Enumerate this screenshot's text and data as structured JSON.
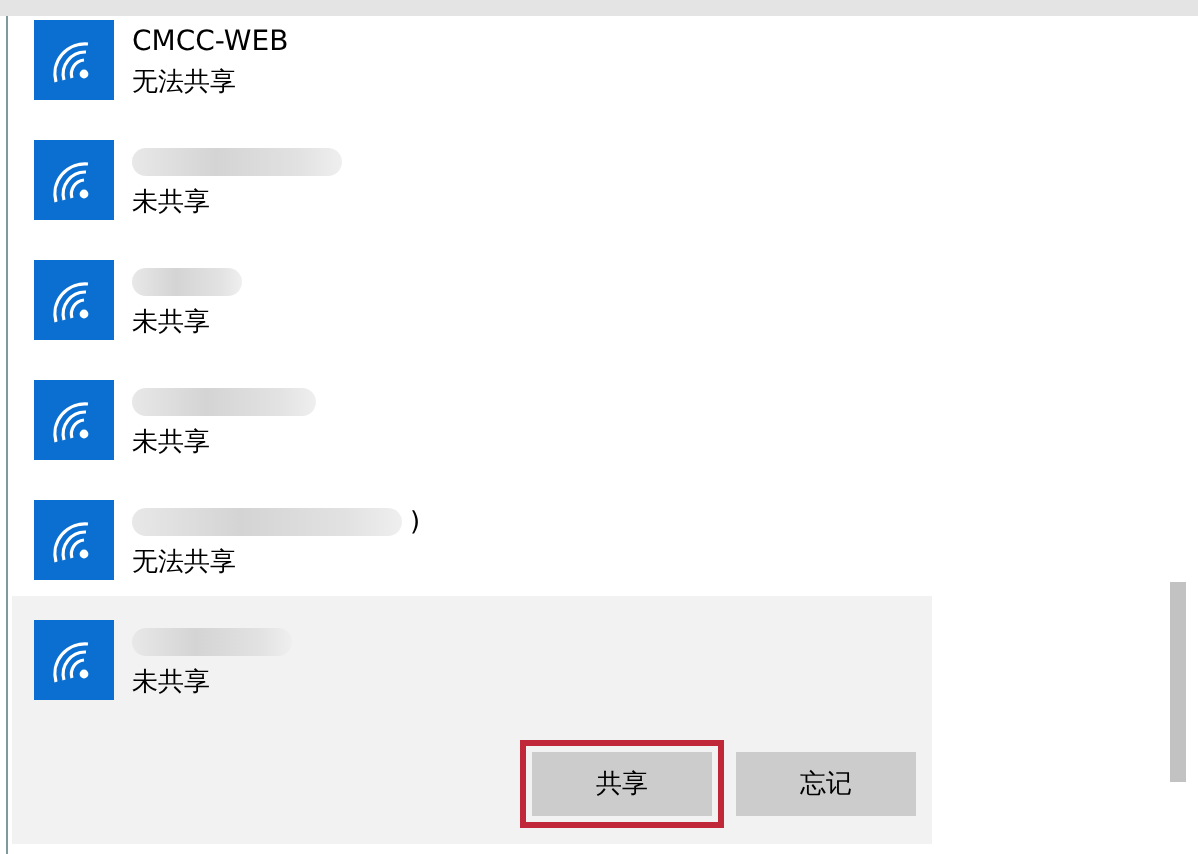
{
  "networks": [
    {
      "name": "CMCC-WEB",
      "status": "无法共享",
      "selected": false
    },
    {
      "status": "未共享",
      "selected": false
    },
    {
      "status": "未共享",
      "selected": false
    },
    {
      "status": "未共享",
      "selected": false
    },
    {
      "name_tail": ")",
      "status": "无法共享",
      "selected": false
    },
    {
      "status": "未共享",
      "selected": true
    }
  ],
  "buttons": [
    {
      "label": "共享",
      "highlighted": true
    },
    {
      "label": "忘记",
      "highlighted": false
    }
  ]
}
